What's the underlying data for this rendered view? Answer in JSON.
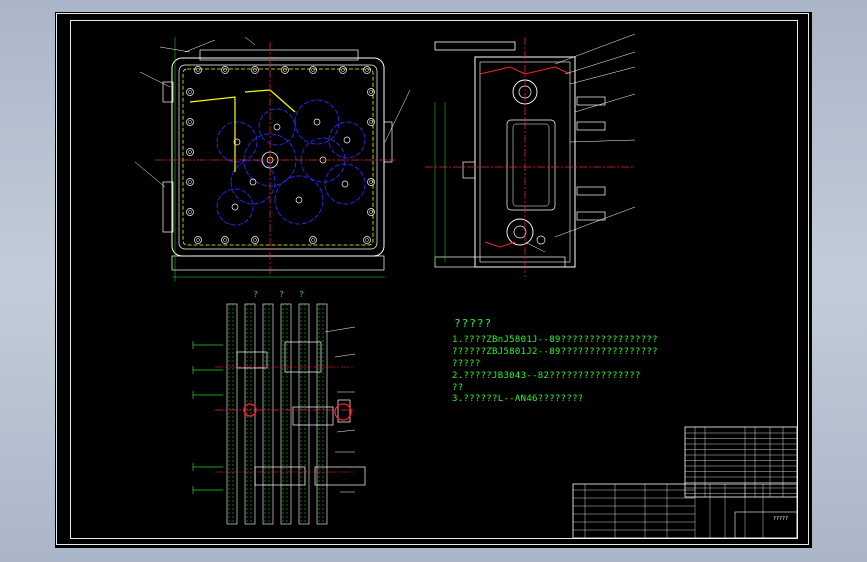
{
  "window": {
    "background_color": "#b3bfcf",
    "canvas_color": "#000000"
  },
  "colors": {
    "frame": "#e8e8e8",
    "outline": "#ffffff",
    "center_line": "#ff2020",
    "hidden_line": "#ffff00",
    "gear_line": "#2a2aff",
    "annotation": "#22dd22",
    "leader": "#ffffff"
  },
  "technical_notes": {
    "title": "?????",
    "line1": "1.????ZBnJ5801J--89?????????????????",
    "line2": "??????ZBJ5801J2--89?????????????????",
    "line3": "?????",
    "line4": "2.?????JB3043--82????????????????",
    "line5": "??",
    "line6": "3.??????L--AN46????????"
  },
  "section_markers": {
    "left": "?",
    "mid": "?",
    "right": "?"
  },
  "title_block": {
    "drawing_title": "?????"
  }
}
